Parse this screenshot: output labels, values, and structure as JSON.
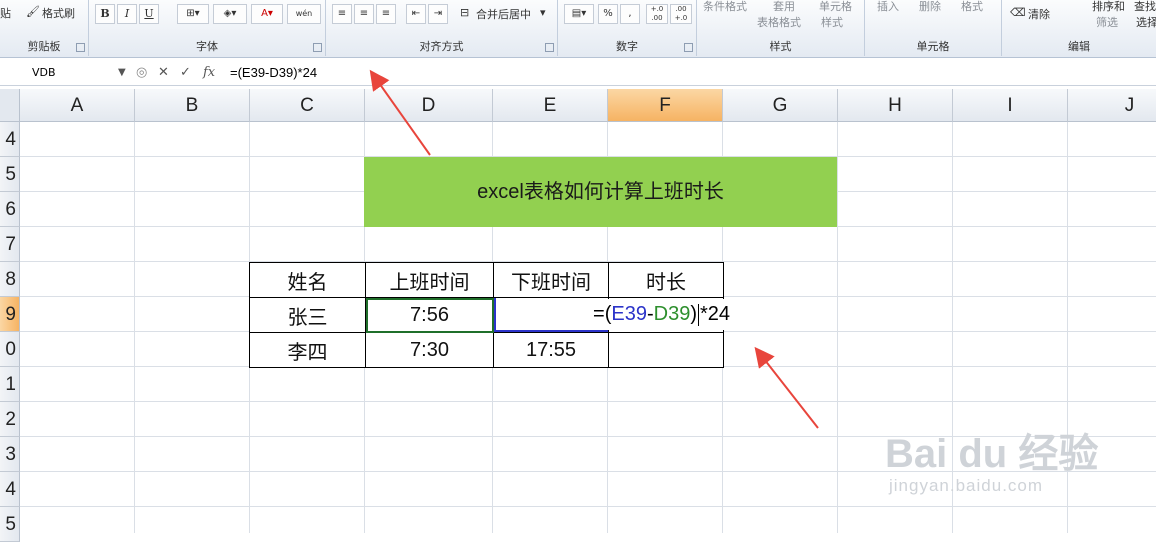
{
  "ribbon": {
    "clipboard": {
      "paste_label": "贴",
      "format_painter_label": "格式刷",
      "group_label": "剪贴板"
    },
    "font": {
      "bold": "B",
      "italic": "I",
      "underline": "U",
      "wen_label": "wén",
      "group_label": "字体"
    },
    "alignment": {
      "merge_center_label": "合并后居中",
      "group_label": "对齐方式"
    },
    "number": {
      "percent": "%",
      "comma": ",",
      "inc_decimal": "+.0 .00",
      "dec_decimal": ".00 +.0",
      "group_label": "数字"
    },
    "styles": {
      "conditional_format": "条件格式",
      "table_format": "表格格式",
      "table_format_top": "套用",
      "cell_style_top": "单元格",
      "cell_style": "样式",
      "group_label": "样式"
    },
    "cells": {
      "insert": "插入",
      "delete": "删除",
      "format": "格式",
      "group_label": "单元格"
    },
    "editing": {
      "clear": "清除",
      "sort_filter_top": "排序和",
      "sort_filter": "筛选",
      "find_select_top": "查找",
      "find_select": "选择",
      "group_label": "编辑"
    }
  },
  "formula_bar": {
    "name_box": "VDB",
    "fx": "fx",
    "cancel": "✕",
    "confirm": "✓",
    "formula": "=(E39-D39)*24"
  },
  "columns": [
    "A",
    "B",
    "C",
    "D",
    "E",
    "F",
    "G",
    "H",
    "I",
    "J"
  ],
  "rows": [
    "4",
    "5",
    "6",
    "7",
    "8",
    "9",
    "0",
    "1",
    "2",
    "3",
    "4",
    "5"
  ],
  "banner_title": "excel表格如何计算上班时长",
  "table": {
    "headers": [
      "姓名",
      "上班时间",
      "下班时间",
      "时长"
    ],
    "rows": [
      [
        "张三",
        "7:56",
        "",
        ""
      ],
      [
        "李四",
        "7:30",
        "17:55",
        ""
      ]
    ]
  },
  "editing_formula": {
    "eq": "=",
    "open": "(",
    "ref1": "E39",
    "minus": "-",
    "ref2": "D39",
    "close": ")",
    "rest": "*24"
  },
  "watermark": {
    "brand": "Bai du 经验",
    "url": "jingyan.baidu.com"
  },
  "colors": {
    "banner": "#92d050",
    "selected_header": "#f6b363",
    "arrow": "#e8453c"
  }
}
